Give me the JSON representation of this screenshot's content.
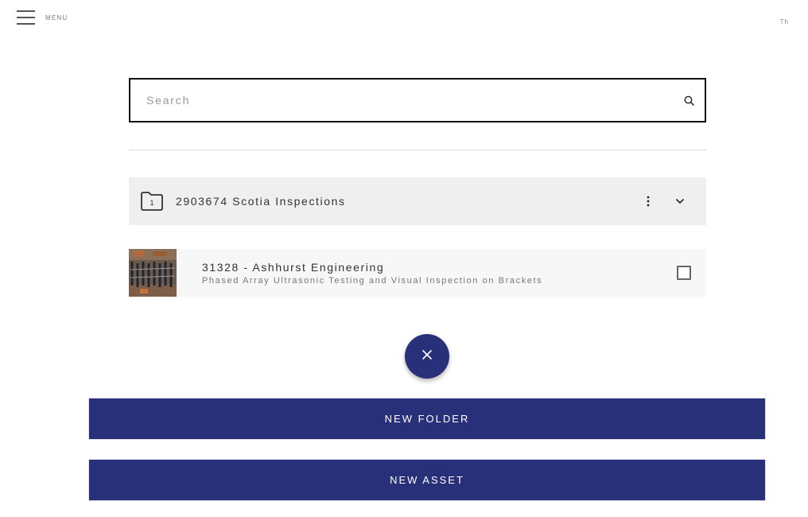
{
  "header": {
    "menu_label": "MENU",
    "menu_icon": "hamburger-icon",
    "user_initials": "Th"
  },
  "search": {
    "placeholder": "Search",
    "value": "",
    "icon": "search-icon"
  },
  "folders": [
    {
      "count": "1",
      "name": "2903674 Scotia Inspections",
      "icons": [
        "folder-icon",
        "kebab-menu-icon",
        "chevron-down-icon"
      ]
    }
  ],
  "assets": [
    {
      "title": "31328 - Ashhurst Engineering",
      "subtitle": "Phased Array Ultrasonic Testing and Visual Inspection on Brackets",
      "checked": false
    }
  ],
  "fab": {
    "icon": "close-icon"
  },
  "buttons": {
    "new_folder": "NEW FOLDER",
    "new_asset": "NEW ASSET"
  },
  "colors": {
    "primary": "#273079",
    "folder_row_bg": "#efefef",
    "asset_row_bg": "#f7f7f7"
  }
}
